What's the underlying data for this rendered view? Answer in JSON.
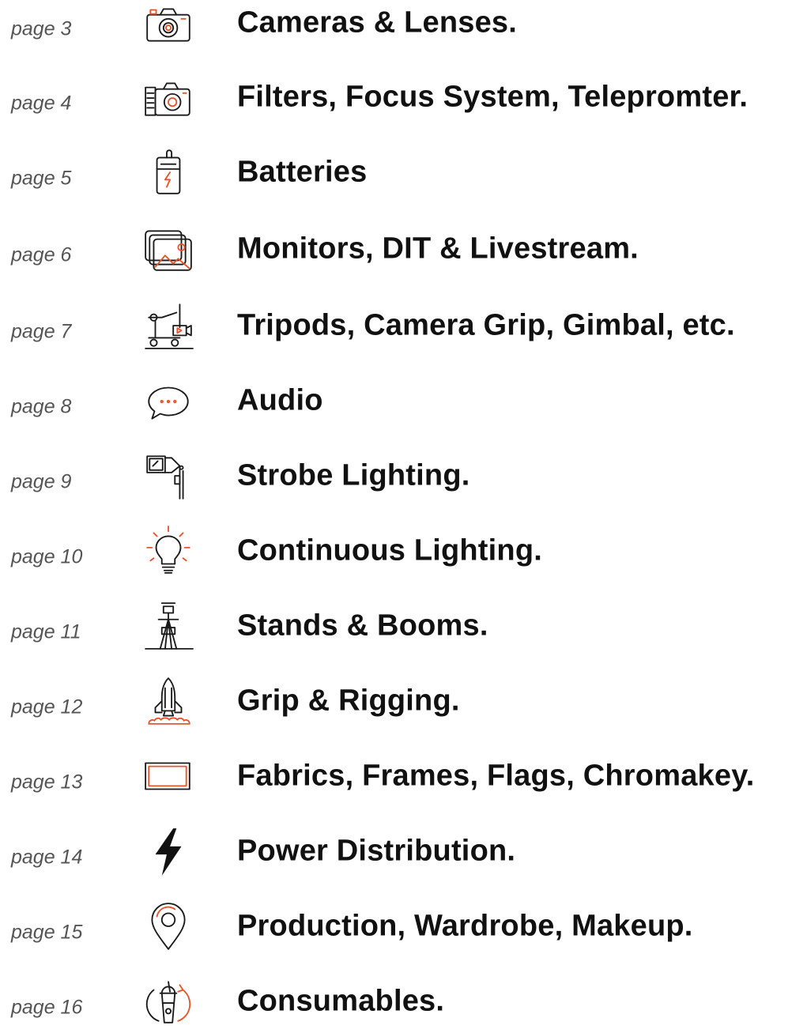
{
  "accent_color": "#e8552a",
  "toc": [
    {
      "page": "page 3",
      "title": "Cameras & Lenses.",
      "icon": "camera-icon"
    },
    {
      "page": "page 4",
      "title": "Filters, Focus System, Telepromter.",
      "icon": "camera-filter-icon"
    },
    {
      "page": "page 5",
      "title": "Batteries",
      "icon": "battery-icon"
    },
    {
      "page": "page 6",
      "title": "Monitors, DIT & Livestream.",
      "icon": "monitor-gallery-icon"
    },
    {
      "page": "page 7",
      "title": "Tripods, Camera Grip, Gimbal, etc.",
      "icon": "camera-crane-icon"
    },
    {
      "page": "page 8",
      "title": "Audio",
      "icon": "speech-bubble-icon"
    },
    {
      "page": "page 9",
      "title": "Strobe Lighting.",
      "icon": "strobe-light-icon"
    },
    {
      "page": "page 10",
      "title": "Continuous Lighting.",
      "icon": "light-bulb-icon"
    },
    {
      "page": "page 11",
      "title": "Stands & Booms.",
      "icon": "light-stand-icon"
    },
    {
      "page": "page 12",
      "title": "Grip & Rigging.",
      "icon": "rocket-icon"
    },
    {
      "page": "page 13",
      "title": "Fabrics, Frames, Flags, Chromakey.",
      "icon": "frame-icon"
    },
    {
      "page": "page 14",
      "title": "Power Distribution.",
      "icon": "lightning-bolt-icon"
    },
    {
      "page": "page 15",
      "title": "Production, Wardrobe, Makeup.",
      "icon": "location-pin-icon"
    },
    {
      "page": "page 16",
      "title": "Consumables.",
      "icon": "takeaway-cup-icon"
    }
  ]
}
